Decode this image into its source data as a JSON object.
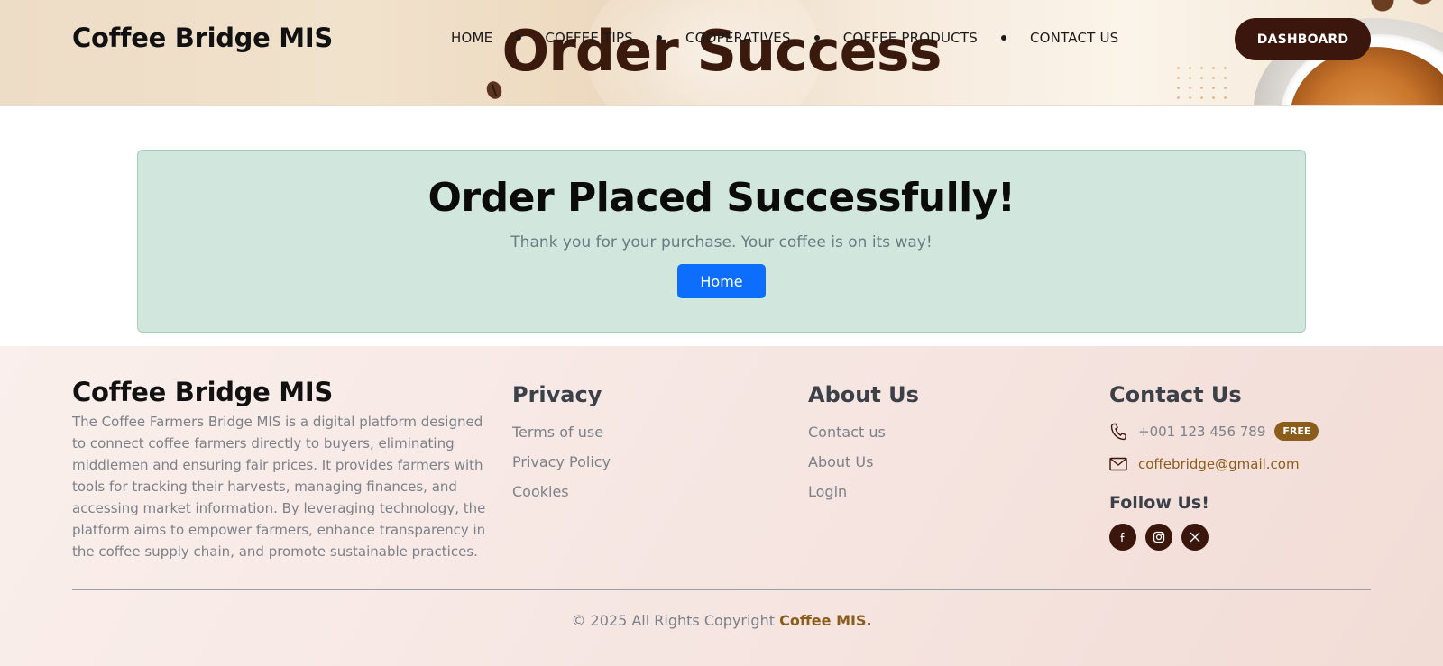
{
  "header": {
    "brand": "Coffee Bridge MIS",
    "hero_title": "Order Success",
    "nav": [
      {
        "label": "HOME"
      },
      {
        "label": "COFFEE TIPS"
      },
      {
        "label": "COOPERATIVES"
      },
      {
        "label": "COFFEE PRODUCTS"
      },
      {
        "label": "CONTACT US"
      }
    ],
    "dashboard_label": "DASHBOARD"
  },
  "success": {
    "title": "Order Placed Successfully!",
    "message": "Thank you for your purchase. Your coffee is on its way!",
    "home_button": "Home"
  },
  "footer": {
    "brand": "Coffee Bridge MIS",
    "description": "The Coffee Farmers Bridge MIS is a digital platform designed to connect coffee farmers directly to buyers, eliminating middlemen and ensuring fair prices. It provides farmers with tools for tracking their harvests, managing finances, and accessing market information. By leveraging technology, the platform aims to empower farmers, enhance transparency in the coffee supply chain, and promote sustainable practices.",
    "privacy": {
      "heading": "Privacy",
      "links": [
        "Terms of use",
        "Privacy Policy",
        "Cookies"
      ]
    },
    "about": {
      "heading": "About Us",
      "links": [
        "Contact us",
        "About Us",
        "Login"
      ]
    },
    "contact": {
      "heading": "Contact Us",
      "phone": "+001 123 456 789",
      "phone_badge": "FREE",
      "email": "coffebridge@gmail.com",
      "follow_heading": "Follow Us!",
      "socials": [
        {
          "icon": "facebook-icon"
        },
        {
          "icon": "instagram-icon"
        },
        {
          "icon": "x-twitter-icon"
        }
      ]
    },
    "copyright_prefix": "© 2025 All Rights Copyright",
    "copyright_brand": "Coffee MIS."
  },
  "colors": {
    "accent_dark": "#3a160c",
    "accent_gold": "#8a5d1c",
    "success_bg": "#d1e7dd",
    "primary_blue": "#0d6efd"
  }
}
